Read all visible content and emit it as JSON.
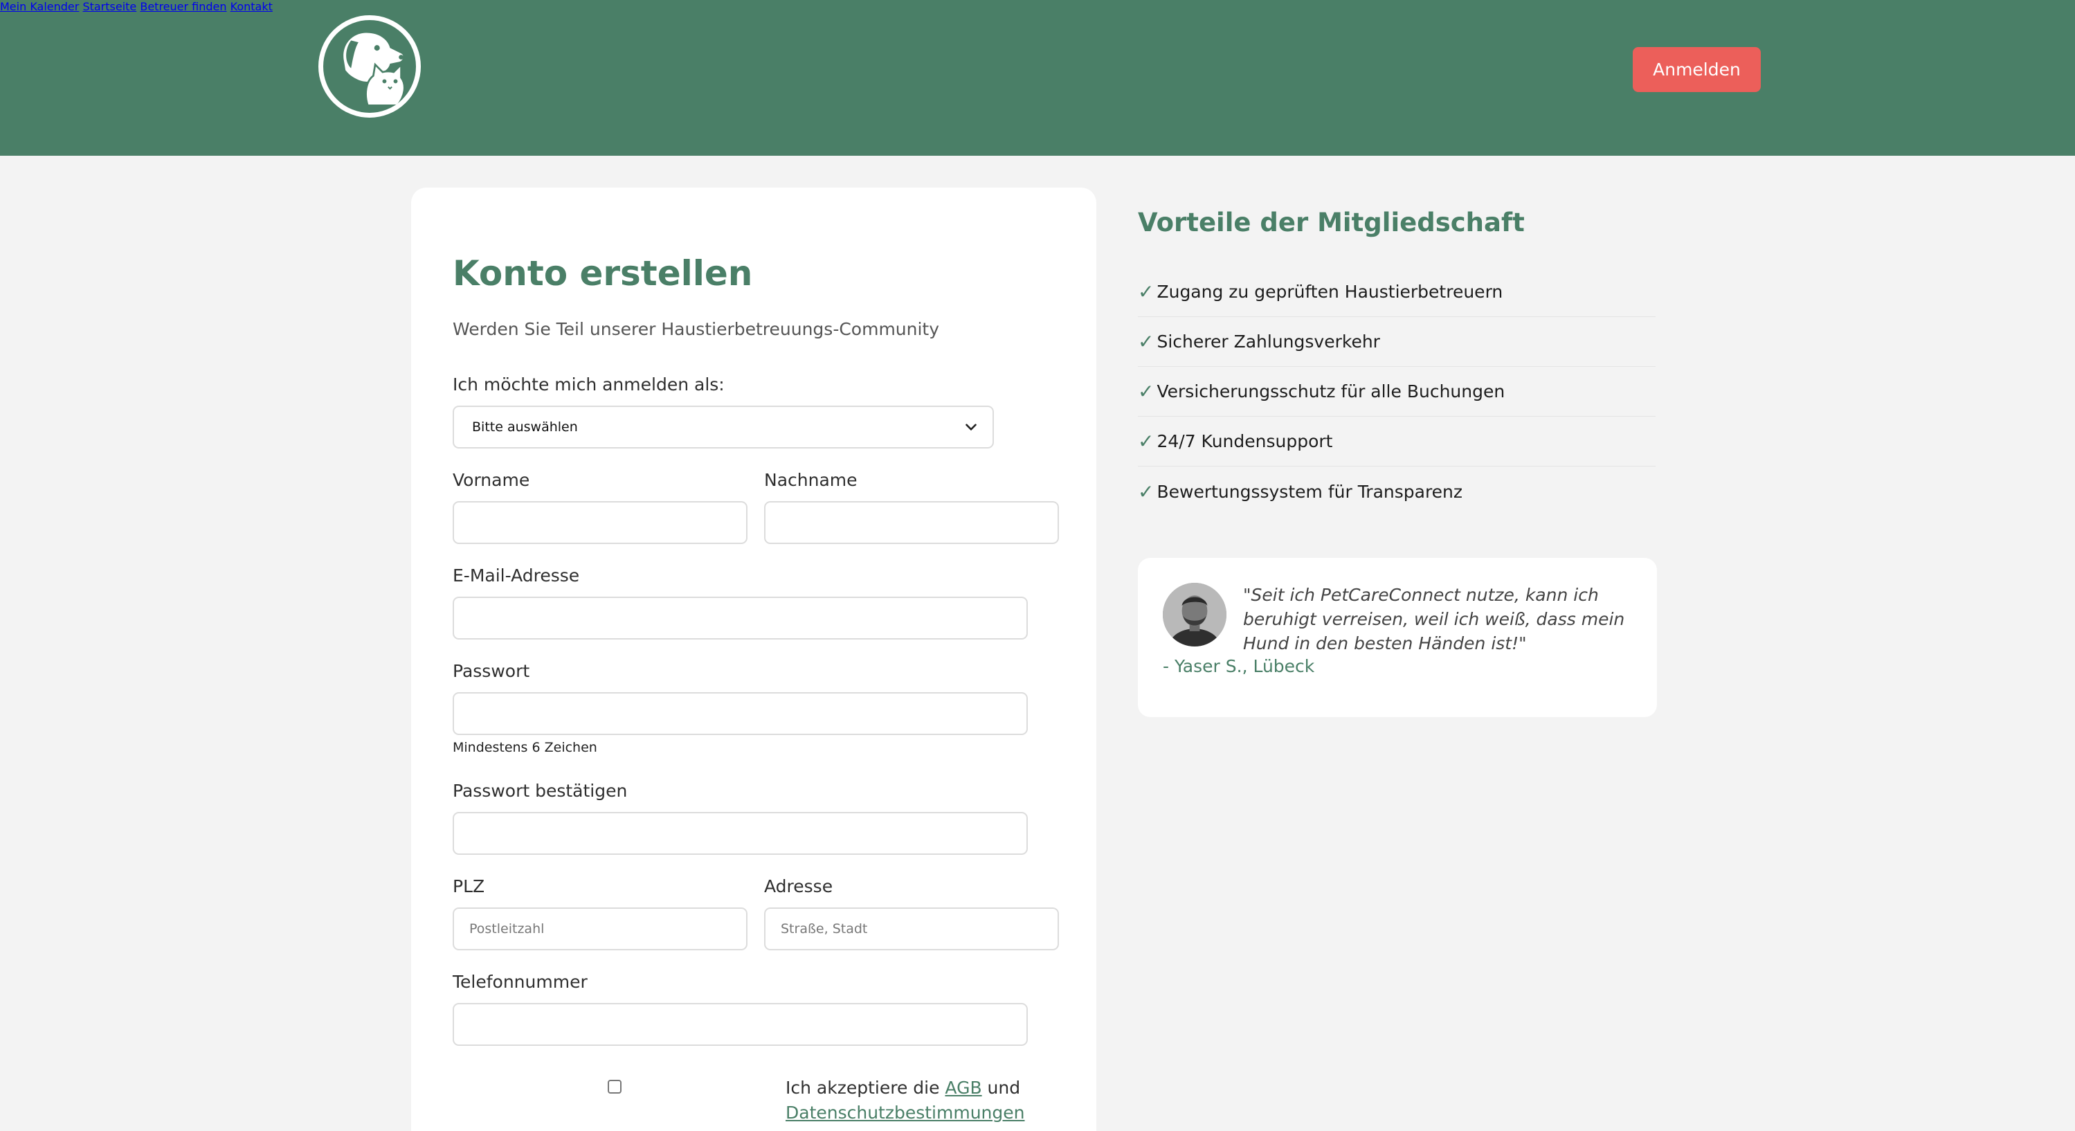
{
  "header": {
    "nav": [
      "Mein Kalender",
      "Startseite",
      "Betreuer finden",
      "Kontakt"
    ],
    "login_label": "Anmelden"
  },
  "form": {
    "title": "Konto erstellen",
    "subtitle": "Werden Sie Teil unserer Haustierbetreuungs-Community",
    "role_label": "Ich möchte mich anmelden als:",
    "role_value": "Bitte auswählen",
    "firstname_label": "Vorname",
    "lastname_label": "Nachname",
    "email_label": "E-Mail-Adresse",
    "password_label": "Passwort",
    "password_hint": "Mindestens 6 Zeichen",
    "password_confirm_label": "Passwort bestätigen",
    "zip_label": "PLZ",
    "zip_placeholder": "Postleitzahl",
    "address_label": "Adresse",
    "address_placeholder": "Straße, Stadt",
    "phone_label": "Telefonnummer",
    "terms_prefix": "Ich akzeptiere die ",
    "terms_agb": "AGB",
    "terms_and": " und",
    "terms_privacy": "Datenschutzbestimmungen"
  },
  "benefits": {
    "title": "Vorteile der Mitgliedschaft",
    "check": "✓",
    "items": [
      "Zugang zu geprüften Haustierbetreuern",
      "Sicherer Zahlungsverkehr",
      "Versicherungsschutz für alle Buchungen",
      "24/7 Kundensupport",
      "Bewertungssystem für Transparenz"
    ]
  },
  "testimonial": {
    "quote": "\"Seit ich PetCareConnect nutze, kann ich beruhigt verreisen, weil ich weiß, dass mein Hund in den besten Händen ist!\"",
    "author": "- Yaser S., Lübeck"
  },
  "colors": {
    "brand": "#4a7f67",
    "accent": "#ec5f5a",
    "background": "#f3f3f3"
  }
}
